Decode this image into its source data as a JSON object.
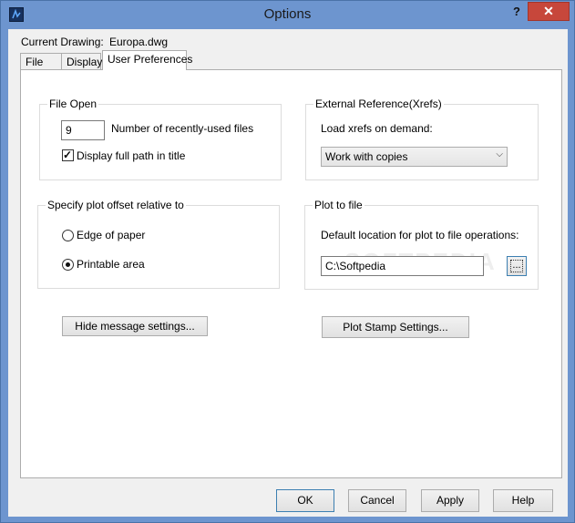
{
  "window": {
    "title": "Options",
    "help_symbol": "?",
    "close_symbol": "✕"
  },
  "header": {
    "current_drawing_label": "Current Drawing:",
    "current_drawing_value": "Europa.dwg"
  },
  "tabs": [
    {
      "label": "File",
      "active": false
    },
    {
      "label": "Display",
      "active": false
    },
    {
      "label": "User Preferences",
      "active": true
    }
  ],
  "file_open": {
    "title": "File Open",
    "recent_count": "9",
    "recent_label": "Number of recently-used files",
    "full_path_label": "Display full path in title",
    "full_path_checked": true
  },
  "xrefs": {
    "title": "External Reference(Xrefs)",
    "load_label": "Load xrefs on demand:",
    "selected": "Work with copies"
  },
  "plot_offset": {
    "title": "Specify plot offset relative to",
    "options": [
      {
        "label": "Edge of paper",
        "selected": false
      },
      {
        "label": "Printable area",
        "selected": true
      }
    ]
  },
  "plot_to_file": {
    "title": "Plot to file",
    "location_label": "Default location for plot to file operations:",
    "location_value": "C:\\Softpedia",
    "browse_label": "..."
  },
  "buttons": {
    "hide_message": "Hide message settings...",
    "plot_stamp": "Plot Stamp Settings...",
    "ok": "OK",
    "cancel": "Cancel",
    "apply": "Apply",
    "help": "Help"
  },
  "watermark": "SOFTPEDIA"
}
